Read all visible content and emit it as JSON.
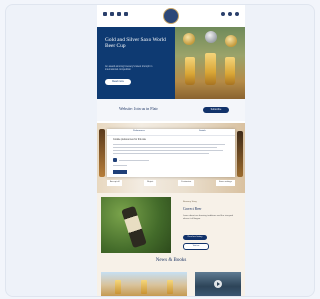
{
  "hero": {
    "title": "Gold and Silver Saxo World Beer Cup",
    "description": "An award-winning brewery's latest triumph in international competition",
    "button": "Read more"
  },
  "cta": {
    "text": "Website: Join us in Flair",
    "button": "Subscribe"
  },
  "modal": {
    "tab_left": "Preferences",
    "tab_right": "Details",
    "heading": "Cookie preferences for this site",
    "links": [
      "Accept all",
      "Reject",
      "Customise",
      "Save settings"
    ]
  },
  "article": {
    "kicker": "Brewery Story",
    "title": "Correct Beer",
    "text": "Learn about our brewing traditions and the vineyard where it all began.",
    "primary_button": "Read our history",
    "secondary_button": "Visit us"
  },
  "news": {
    "title": "News & Books"
  },
  "colors": {
    "navy": "#0e3a72",
    "cream": "#f7f1e8",
    "gold": "#c49a3c"
  }
}
